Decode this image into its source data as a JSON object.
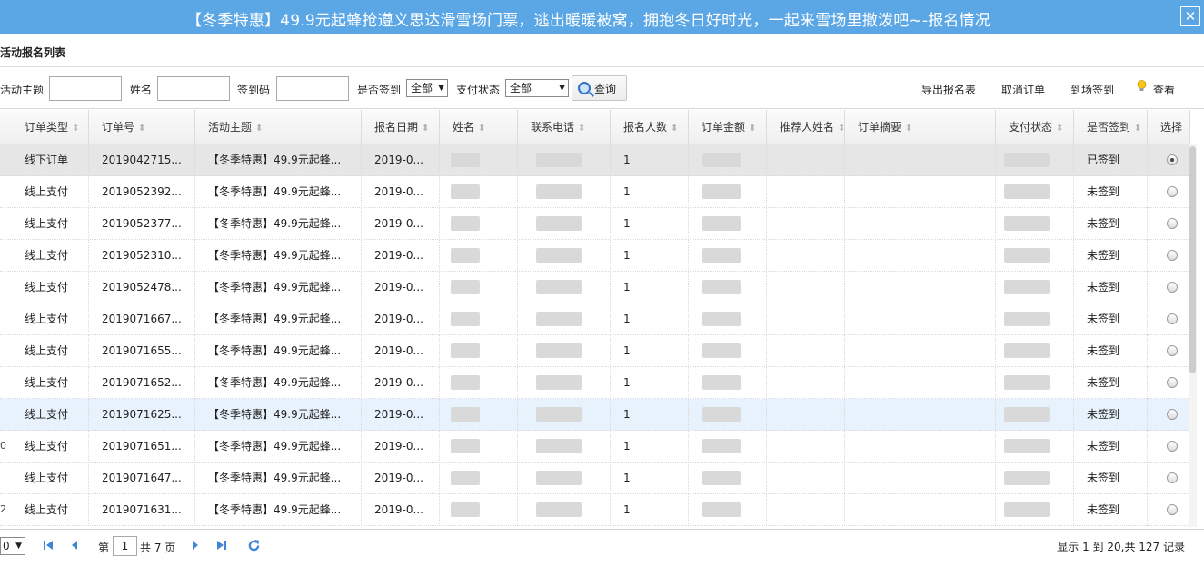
{
  "window": {
    "title": "【冬季特惠】49.9元起蜂抢遵义思达滑雪场门票，逃出暖暖被窝，拥抱冬日好时光，一起来雪场里撒泼吧~-报名情况",
    "close_glyph": "✕"
  },
  "panel": {
    "title": "活动报名列表"
  },
  "filters": {
    "topic_label": "活动主题",
    "name_label": "姓名",
    "code_label": "签到码",
    "signed_label": "是否签到",
    "signed_value": "全部",
    "pay_label": "支付状态",
    "pay_value": "全部",
    "query_label": "查询"
  },
  "actions": {
    "export": "导出报名表",
    "cancel_order": "取消订单",
    "checkin": "到场签到",
    "view": "查看"
  },
  "columns": [
    "订单类型",
    "订单号",
    "活动主题",
    "报名日期",
    "姓名",
    "联系电话",
    "报名人数",
    "订单金额",
    "推荐人姓名",
    "订单摘要",
    "支付状态",
    "是否签到",
    "选择"
  ],
  "rows": [
    {
      "n": "",
      "type": "线下订单",
      "order_no": "2019042715...",
      "topic": "【冬季特惠】49.9元起蜂...",
      "date": "2019-0...",
      "count": "1",
      "signed": "已签到",
      "selected": true
    },
    {
      "n": "",
      "type": "线上支付",
      "order_no": "2019052392...",
      "topic": "【冬季特惠】49.9元起蜂...",
      "date": "2019-0...",
      "count": "1",
      "signed": "未签到",
      "selected": false
    },
    {
      "n": "",
      "type": "线上支付",
      "order_no": "2019052377...",
      "topic": "【冬季特惠】49.9元起蜂...",
      "date": "2019-0...",
      "count": "1",
      "signed": "未签到",
      "selected": false
    },
    {
      "n": "",
      "type": "线上支付",
      "order_no": "2019052310...",
      "topic": "【冬季特惠】49.9元起蜂...",
      "date": "2019-0...",
      "count": "1",
      "signed": "未签到",
      "selected": false
    },
    {
      "n": "",
      "type": "线上支付",
      "order_no": "2019052478...",
      "topic": "【冬季特惠】49.9元起蜂...",
      "date": "2019-0...",
      "count": "1",
      "signed": "未签到",
      "selected": false
    },
    {
      "n": "",
      "type": "线上支付",
      "order_no": "2019071667...",
      "topic": "【冬季特惠】49.9元起蜂...",
      "date": "2019-0...",
      "count": "1",
      "signed": "未签到",
      "selected": false
    },
    {
      "n": "",
      "type": "线上支付",
      "order_no": "2019071655...",
      "topic": "【冬季特惠】49.9元起蜂...",
      "date": "2019-0...",
      "count": "1",
      "signed": "未签到",
      "selected": false
    },
    {
      "n": "",
      "type": "线上支付",
      "order_no": "2019071652...",
      "topic": "【冬季特惠】49.9元起蜂...",
      "date": "2019-0...",
      "count": "1",
      "signed": "未签到",
      "selected": false
    },
    {
      "n": "",
      "type": "线上支付",
      "order_no": "2019071625...",
      "topic": "【冬季特惠】49.9元起蜂...",
      "date": "2019-0...",
      "count": "1",
      "signed": "未签到",
      "selected": false,
      "hover": true
    },
    {
      "n": "0",
      "type": "线上支付",
      "order_no": "2019071651...",
      "topic": "【冬季特惠】49.9元起蜂...",
      "date": "2019-0...",
      "count": "1",
      "signed": "未签到",
      "selected": false
    },
    {
      "n": "",
      "type": "线上支付",
      "order_no": "2019071647...",
      "topic": "【冬季特惠】49.9元起蜂...",
      "date": "2019-0...",
      "count": "1",
      "signed": "未签到",
      "selected": false
    },
    {
      "n": "2",
      "type": "线上支付",
      "order_no": "2019071631...",
      "topic": "【冬季特惠】49.9元起蜂...",
      "date": "2019-0...",
      "count": "1",
      "signed": "未签到",
      "selected": false
    }
  ],
  "pager": {
    "page_size": "0",
    "page_prefix": "第",
    "page_value": "1",
    "page_suffix": "共 7 页",
    "info": "显示 1 到 20,共 127 记录"
  },
  "colors": {
    "title_bar": "#5ba7e6",
    "selected_row": "#e6e6e6",
    "hover_row": "#e8f2fd",
    "pager_icon": "#3f86d6"
  }
}
